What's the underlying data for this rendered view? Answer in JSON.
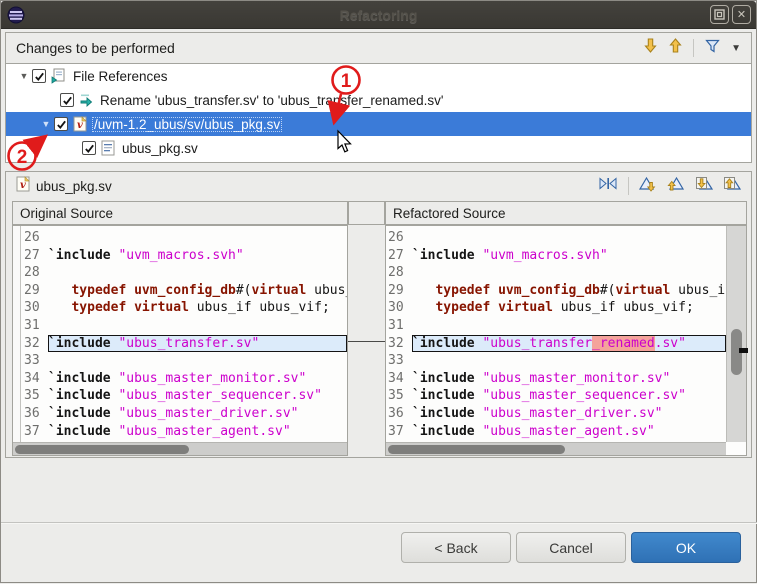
{
  "window": {
    "title": "Refactoring"
  },
  "changes": {
    "header": "Changes to be performed",
    "tree": [
      {
        "level": 0,
        "expander": true,
        "checked": true,
        "icon": "file-references",
        "label": "File References",
        "selected": false
      },
      {
        "level": 1,
        "expander": false,
        "checked": true,
        "icon": "rename",
        "label": "Rename 'ubus_transfer.sv' to 'ubus_transfer_renamed.sv'",
        "selected": false
      },
      {
        "level": 1,
        "expander": true,
        "checked": true,
        "icon": "sv-file",
        "label": "/uvm-1.2_ubus/sv/ubus_pkg.sv",
        "selected": true
      },
      {
        "level": 2,
        "expander": false,
        "checked": true,
        "icon": "compare-file",
        "label": "ubus_pkg.sv",
        "selected": false
      }
    ]
  },
  "annotations": {
    "one": "1",
    "two": "2"
  },
  "compare": {
    "file_label": "ubus_pkg.sv",
    "left_title": "Original Source",
    "right_title": "Refactored Source",
    "left_lines": [
      {
        "n": "26",
        "segs": []
      },
      {
        "n": "27",
        "segs": [
          {
            "t": "`include",
            "y": "dir"
          },
          {
            "t": " ",
            "y": "pl"
          },
          {
            "t": "\"uvm_macros.svh\"",
            "y": "str"
          }
        ]
      },
      {
        "n": "28",
        "segs": []
      },
      {
        "n": "29",
        "segs": [
          {
            "t": "   ",
            "y": "pl"
          },
          {
            "t": "typedef",
            "y": "kw"
          },
          {
            "t": " ",
            "y": "pl"
          },
          {
            "t": "uvm_config_db",
            "y": "kw"
          },
          {
            "t": "#(",
            "y": "pl"
          },
          {
            "t": "virtual",
            "y": "kw"
          },
          {
            "t": " ubus_",
            "y": "pl"
          }
        ]
      },
      {
        "n": "30",
        "segs": [
          {
            "t": "   ",
            "y": "pl"
          },
          {
            "t": "typedef",
            "y": "kw"
          },
          {
            "t": " ",
            "y": "pl"
          },
          {
            "t": "virtual",
            "y": "kw"
          },
          {
            "t": " ubus_if ubus_vif;",
            "y": "pl"
          }
        ]
      },
      {
        "n": "31",
        "segs": []
      },
      {
        "n": "32",
        "hl": true,
        "segs": [
          {
            "t": "`include",
            "y": "dir"
          },
          {
            "t": " ",
            "y": "pl"
          },
          {
            "t": "\"ubus_transfer.sv\"",
            "y": "str"
          }
        ]
      },
      {
        "n": "33",
        "segs": []
      },
      {
        "n": "34",
        "segs": [
          {
            "t": "`include",
            "y": "dir"
          },
          {
            "t": " ",
            "y": "pl"
          },
          {
            "t": "\"ubus_master_monitor.sv\"",
            "y": "str"
          }
        ]
      },
      {
        "n": "35",
        "segs": [
          {
            "t": "`include",
            "y": "dir"
          },
          {
            "t": " ",
            "y": "pl"
          },
          {
            "t": "\"ubus_master_sequencer.sv\"",
            "y": "str"
          }
        ]
      },
      {
        "n": "36",
        "segs": [
          {
            "t": "`include",
            "y": "dir"
          },
          {
            "t": " ",
            "y": "pl"
          },
          {
            "t": "\"ubus_master_driver.sv\"",
            "y": "str"
          }
        ]
      },
      {
        "n": "37",
        "segs": [
          {
            "t": "`include",
            "y": "dir"
          },
          {
            "t": " ",
            "y": "pl"
          },
          {
            "t": "\"ubus_master_agent.sv\"",
            "y": "str"
          }
        ]
      }
    ],
    "right_lines": [
      {
        "n": "26",
        "segs": []
      },
      {
        "n": "27",
        "segs": [
          {
            "t": "`include",
            "y": "dir"
          },
          {
            "t": " ",
            "y": "pl"
          },
          {
            "t": "\"uvm_macros.svh\"",
            "y": "str"
          }
        ]
      },
      {
        "n": "28",
        "segs": []
      },
      {
        "n": "29",
        "segs": [
          {
            "t": "   ",
            "y": "pl"
          },
          {
            "t": "typedef",
            "y": "kw"
          },
          {
            "t": " ",
            "y": "pl"
          },
          {
            "t": "uvm_config_db",
            "y": "kw"
          },
          {
            "t": "#(",
            "y": "pl"
          },
          {
            "t": "virtual",
            "y": "kw"
          },
          {
            "t": " ubus_i",
            "y": "pl"
          }
        ]
      },
      {
        "n": "30",
        "segs": [
          {
            "t": "   ",
            "y": "pl"
          },
          {
            "t": "typedef",
            "y": "kw"
          },
          {
            "t": " ",
            "y": "pl"
          },
          {
            "t": "virtual",
            "y": "kw"
          },
          {
            "t": " ubus_if ubus_vif;",
            "y": "pl"
          }
        ]
      },
      {
        "n": "31",
        "segs": []
      },
      {
        "n": "32",
        "hl": true,
        "segs": [
          {
            "t": "`include",
            "y": "dir"
          },
          {
            "t": " ",
            "y": "pl"
          },
          {
            "t": "\"ubus_transfer",
            "y": "str"
          },
          {
            "t": "_renamed",
            "y": "strhl"
          },
          {
            "t": ".sv\"",
            "y": "str"
          }
        ]
      },
      {
        "n": "33",
        "segs": []
      },
      {
        "n": "34",
        "segs": [
          {
            "t": "`include",
            "y": "dir"
          },
          {
            "t": " ",
            "y": "pl"
          },
          {
            "t": "\"ubus_master_monitor.sv\"",
            "y": "str"
          }
        ]
      },
      {
        "n": "35",
        "segs": [
          {
            "t": "`include",
            "y": "dir"
          },
          {
            "t": " ",
            "y": "pl"
          },
          {
            "t": "\"ubus_master_sequencer.sv\"",
            "y": "str"
          }
        ]
      },
      {
        "n": "36",
        "segs": [
          {
            "t": "`include",
            "y": "dir"
          },
          {
            "t": " ",
            "y": "pl"
          },
          {
            "t": "\"ubus_master_driver.sv\"",
            "y": "str"
          }
        ]
      },
      {
        "n": "37",
        "segs": [
          {
            "t": "`include",
            "y": "dir"
          },
          {
            "t": " ",
            "y": "pl"
          },
          {
            "t": "\"ubus_master_agent.sv\"",
            "y": "str"
          }
        ]
      }
    ]
  },
  "buttons": {
    "back": "< Back",
    "cancel": "Cancel",
    "ok": "OK"
  },
  "colors": {
    "selection_blue": "#3b7bd8",
    "ok_button_blue": "#3079c0",
    "annotation_red": "#e01b1b",
    "keyword_maroon": "#871400",
    "string_magenta": "#cc00cc",
    "renamed_highlight": "#f4a39b",
    "diff_line_highlight": "#dcebfa",
    "titlebar_dark": "#3b3934"
  }
}
